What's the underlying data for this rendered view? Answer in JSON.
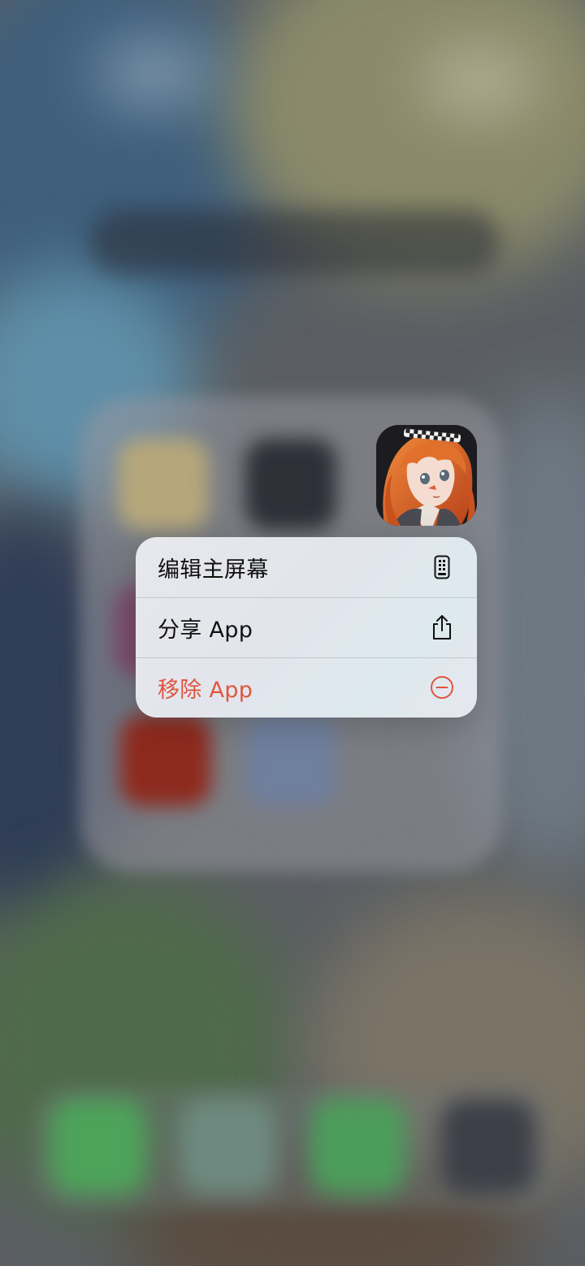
{
  "context_menu": {
    "items": [
      {
        "label": "编辑主屏幕",
        "icon": "phone-edit-icon",
        "destructive": false
      },
      {
        "label": "分享 App",
        "icon": "share-icon",
        "destructive": false
      },
      {
        "label": "移除 App",
        "icon": "minus-circle-icon",
        "destructive": true
      }
    ]
  },
  "colors": {
    "destructive": "#e0553f",
    "menu_background": "#e5e6ec",
    "label": "#111111"
  }
}
